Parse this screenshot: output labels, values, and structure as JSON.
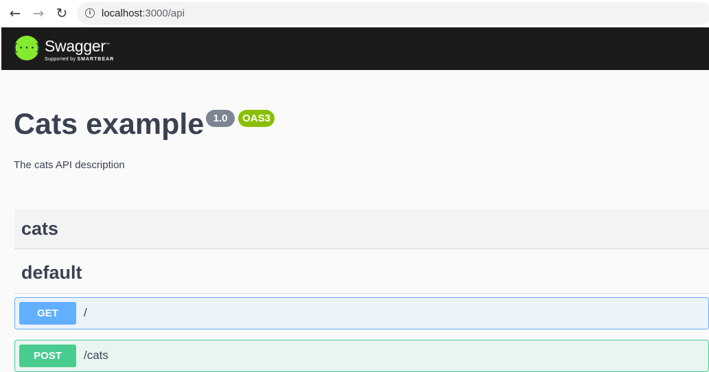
{
  "browser": {
    "url_host": "localhost",
    "url_path": ":3000/api",
    "back_icon": "arrow-left-icon",
    "forward_icon": "arrow-right-icon",
    "reload_icon": "reload-icon",
    "info_icon": "info-icon"
  },
  "topbar": {
    "logo_glyph": "{···}",
    "brand": "Swagger",
    "tm": "™",
    "supported_by": "Supported by",
    "company": "SMARTBEAR"
  },
  "info": {
    "title": "Cats example",
    "version": "1.0",
    "oas": "OAS3",
    "description": "The cats API description"
  },
  "tags": [
    {
      "label": "cats"
    },
    {
      "label": "default"
    }
  ],
  "operations": [
    {
      "method": "GET",
      "path": "/"
    },
    {
      "method": "POST",
      "path": "/cats"
    }
  ],
  "colors": {
    "get": "#61affe",
    "post": "#49cc90",
    "swagger_green": "#85ea2d",
    "topbar_bg": "#1b1b1b",
    "oas_badge": "#89bf04",
    "version_badge": "#7d8492"
  }
}
